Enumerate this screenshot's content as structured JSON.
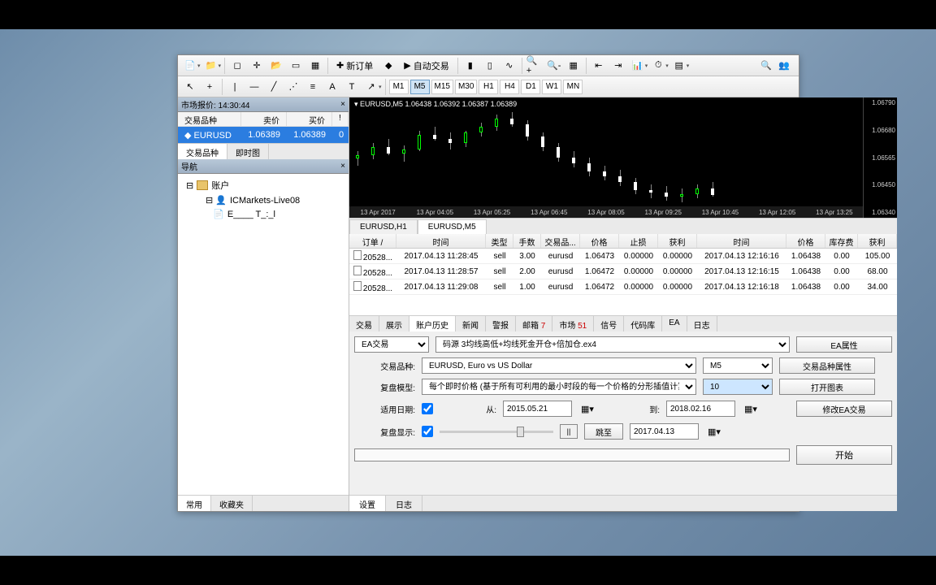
{
  "toolbar": {
    "new_order": "新订单",
    "auto_trade": "自动交易"
  },
  "timeframes": [
    "M1",
    "M5",
    "M15",
    "M30",
    "H1",
    "H4",
    "D1",
    "W1",
    "MN"
  ],
  "market_watch": {
    "title": "市场报价: 14:30:44",
    "cols": {
      "symbol": "交易品种",
      "bid": "卖价",
      "ask": "买价",
      "spread": "!"
    },
    "rows": [
      {
        "symbol": "EURUSD",
        "bid": "1.06389",
        "ask": "1.06389",
        "spread": "0"
      }
    ],
    "tabs": [
      "交易品种",
      "即时图"
    ]
  },
  "navigator": {
    "title": "导航",
    "accounts": "账户",
    "items": [
      "ICMarkets-Live08",
      "E____ T_:_l"
    ],
    "tabs": [
      "常用",
      "收藏夹"
    ]
  },
  "chart": {
    "title": "EURUSD,M5  1.06438  1.06392  1.06387  1.06389",
    "xlabels": [
      "13 Apr 2017",
      "13 Apr 04:05",
      "13 Apr 05:25",
      "13 Apr 06:45",
      "13 Apr 08:05",
      "13 Apr 09:25",
      "13 Apr 10:45",
      "13 Apr 12:05",
      "13 Apr 13:25"
    ],
    "ylabels": [
      "1.06790",
      "1.06680",
      "1.06565",
      "1.06450",
      "1.06340"
    ],
    "tabs": [
      "EURUSD,H1",
      "EURUSD,M5"
    ]
  },
  "grid": {
    "cols": {
      "order": "订单 /",
      "time": "时间",
      "type": "类型",
      "lots": "手数",
      "symbol": "交易品...",
      "price": "价格",
      "sl": "止损",
      "tp": "获利",
      "time2": "时间",
      "price2": "价格",
      "swap": "库存费",
      "profit": "获利"
    },
    "rows": [
      {
        "order": "20528...",
        "time": "2017.04.13 11:28:45",
        "type": "sell",
        "lots": "3.00",
        "symbol": "eurusd",
        "price": "1.06473",
        "sl": "0.00000",
        "tp": "0.00000",
        "time2": "2017.04.13 12:16:16",
        "price2": "1.06438",
        "swap": "0.00",
        "profit": "105.00"
      },
      {
        "order": "20528...",
        "time": "2017.04.13 11:28:57",
        "type": "sell",
        "lots": "2.00",
        "symbol": "eurusd",
        "price": "1.06472",
        "sl": "0.00000",
        "tp": "0.00000",
        "time2": "2017.04.13 12:16:15",
        "price2": "1.06438",
        "swap": "0.00",
        "profit": "68.00"
      },
      {
        "order": "20528...",
        "time": "2017.04.13 11:29:08",
        "type": "sell",
        "lots": "1.00",
        "symbol": "eurusd",
        "price": "1.06472",
        "sl": "0.00000",
        "tp": "0.00000",
        "time2": "2017.04.13 12:16:18",
        "price2": "1.06438",
        "swap": "0.00",
        "profit": "34.00"
      }
    ],
    "tabs": [
      "交易",
      "展示",
      "账户历史",
      "新闻",
      "警报",
      "邮箱",
      "市场",
      "信号",
      "代码库",
      "EA",
      "日志"
    ],
    "mail_count": "7",
    "market_count": "51"
  },
  "tester": {
    "type_label": "EA交易",
    "ea_file": "码源 3均线高低+均线死金开仓+倍加仓.ex4",
    "symbol_label": "交易品种:",
    "symbol_value": "EURUSD, Euro vs US Dollar",
    "period_value": "M5",
    "model_label": "复盘模型:",
    "model_value": "每个即时价格 (基于所有可利用的最小时段的每一个价格的分形插值计算)",
    "spread_value": "10",
    "use_date_label": "适用日期:",
    "from_label": "从:",
    "from_date": "2015.05.21",
    "to_label": "到:",
    "to_date": "2018.02.16",
    "vis_label": "复盘显示:",
    "skip_label": "跳至",
    "skip_date": "2017.04.13",
    "btn_props": "EA属性",
    "btn_symprops": "交易品种属性",
    "btn_chart": "打开图表",
    "btn_modify": "修改EA交易",
    "btn_start": "开始",
    "tabs": [
      "设置",
      "日志"
    ]
  },
  "chart_data": {
    "type": "candlestick",
    "symbol": "EURUSD",
    "timeframe": "M5",
    "ylim": [
      1.0634,
      1.0679
    ],
    "x_range": [
      "2017-04-13 02:45",
      "2017-04-13 13:25"
    ],
    "note": "values approximated from pixel positions",
    "series": [
      {
        "o": 1.06565,
        "h": 1.066,
        "l": 1.0653,
        "c": 1.0658
      },
      {
        "o": 1.0658,
        "h": 1.0664,
        "l": 1.0656,
        "c": 1.0662
      },
      {
        "o": 1.0662,
        "h": 1.0666,
        "l": 1.0658,
        "c": 1.0659
      },
      {
        "o": 1.0659,
        "h": 1.0663,
        "l": 1.0655,
        "c": 1.0661
      },
      {
        "o": 1.0661,
        "h": 1.067,
        "l": 1.066,
        "c": 1.0668
      },
      {
        "o": 1.0668,
        "h": 1.0672,
        "l": 1.0665,
        "c": 1.0666
      },
      {
        "o": 1.0666,
        "h": 1.0669,
        "l": 1.0661,
        "c": 1.0664
      },
      {
        "o": 1.0664,
        "h": 1.067,
        "l": 1.0662,
        "c": 1.0669
      },
      {
        "o": 1.0669,
        "h": 1.0674,
        "l": 1.0667,
        "c": 1.0672
      },
      {
        "o": 1.0672,
        "h": 1.0678,
        "l": 1.067,
        "c": 1.0676
      },
      {
        "o": 1.0676,
        "h": 1.0679,
        "l": 1.0672,
        "c": 1.0673
      },
      {
        "o": 1.0673,
        "h": 1.0675,
        "l": 1.0665,
        "c": 1.0667
      },
      {
        "o": 1.0667,
        "h": 1.0669,
        "l": 1.066,
        "c": 1.0662
      },
      {
        "o": 1.0662,
        "h": 1.0664,
        "l": 1.0655,
        "c": 1.0657
      },
      {
        "o": 1.0657,
        "h": 1.066,
        "l": 1.0652,
        "c": 1.0654
      },
      {
        "o": 1.0654,
        "h": 1.0657,
        "l": 1.0648,
        "c": 1.065
      },
      {
        "o": 1.065,
        "h": 1.0653,
        "l": 1.0646,
        "c": 1.0648
      },
      {
        "o": 1.0648,
        "h": 1.0651,
        "l": 1.0643,
        "c": 1.0645
      },
      {
        "o": 1.0645,
        "h": 1.0647,
        "l": 1.0639,
        "c": 1.0641
      },
      {
        "o": 1.0641,
        "h": 1.0644,
        "l": 1.0637,
        "c": 1.064
      },
      {
        "o": 1.064,
        "h": 1.0643,
        "l": 1.0636,
        "c": 1.0638
      },
      {
        "o": 1.0638,
        "h": 1.0642,
        "l": 1.0635,
        "c": 1.0639
      },
      {
        "o": 1.0639,
        "h": 1.0644,
        "l": 1.0637,
        "c": 1.0642
      },
      {
        "o": 1.0642,
        "h": 1.0645,
        "l": 1.0638,
        "c": 1.06389
      }
    ]
  }
}
